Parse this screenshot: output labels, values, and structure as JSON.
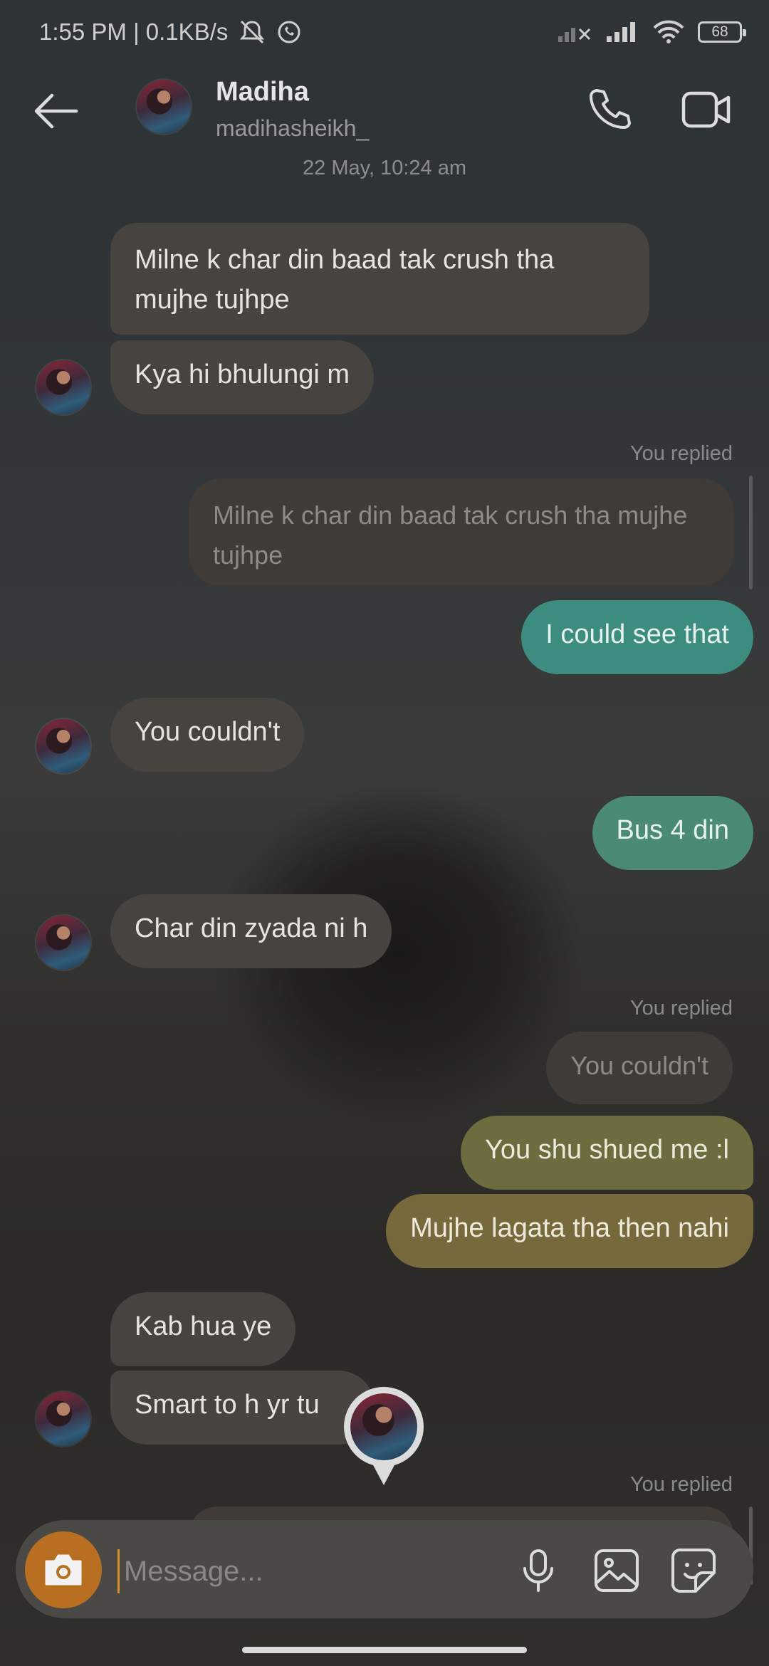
{
  "status_bar": {
    "time_speed": "1:55 PM | 0.1KB/s",
    "battery": "68"
  },
  "header": {
    "name": "Madiha",
    "username": "madihasheikh_"
  },
  "thread": {
    "date_separator": "22 May, 10:24 am",
    "messages": [
      {
        "from": "them",
        "text": "Milne k char din baad tak crush tha mujhe tujhpe"
      },
      {
        "from": "them",
        "text": "Kya hi bhulungi m"
      },
      {
        "from": "me",
        "reply_label": "You replied",
        "reply_preview": "Milne k char din baad tak crush tha mujhe tujhpe",
        "text": "I could see that"
      },
      {
        "from": "them",
        "text": "You couldn't"
      },
      {
        "from": "me",
        "text": "Bus 4 din"
      },
      {
        "from": "them",
        "text": "Char din zyada ni h"
      },
      {
        "from": "me",
        "reply_label": "You replied",
        "reply_preview": "You couldn't",
        "text": "You shu shued me :l"
      },
      {
        "from": "me",
        "text": "Mujhe lagata tha then nahi"
      },
      {
        "from": "them",
        "text": "Kab hua ye"
      },
      {
        "from": "them",
        "text": "Smart to h yr tu"
      },
      {
        "from": "me",
        "reply_label": "You replied"
      }
    ]
  },
  "composer": {
    "placeholder": "Message..."
  },
  "colors": {
    "incoming_bubble": "#47433e",
    "outgoing_teal": "#3d8c80",
    "outgoing_olive": "#6e6a3c",
    "camera_button": "#b86f22"
  },
  "icons": [
    "back-arrow-icon",
    "phone-icon",
    "video-call-icon",
    "camera-icon",
    "microphone-icon",
    "gallery-icon",
    "sticker-icon"
  ]
}
